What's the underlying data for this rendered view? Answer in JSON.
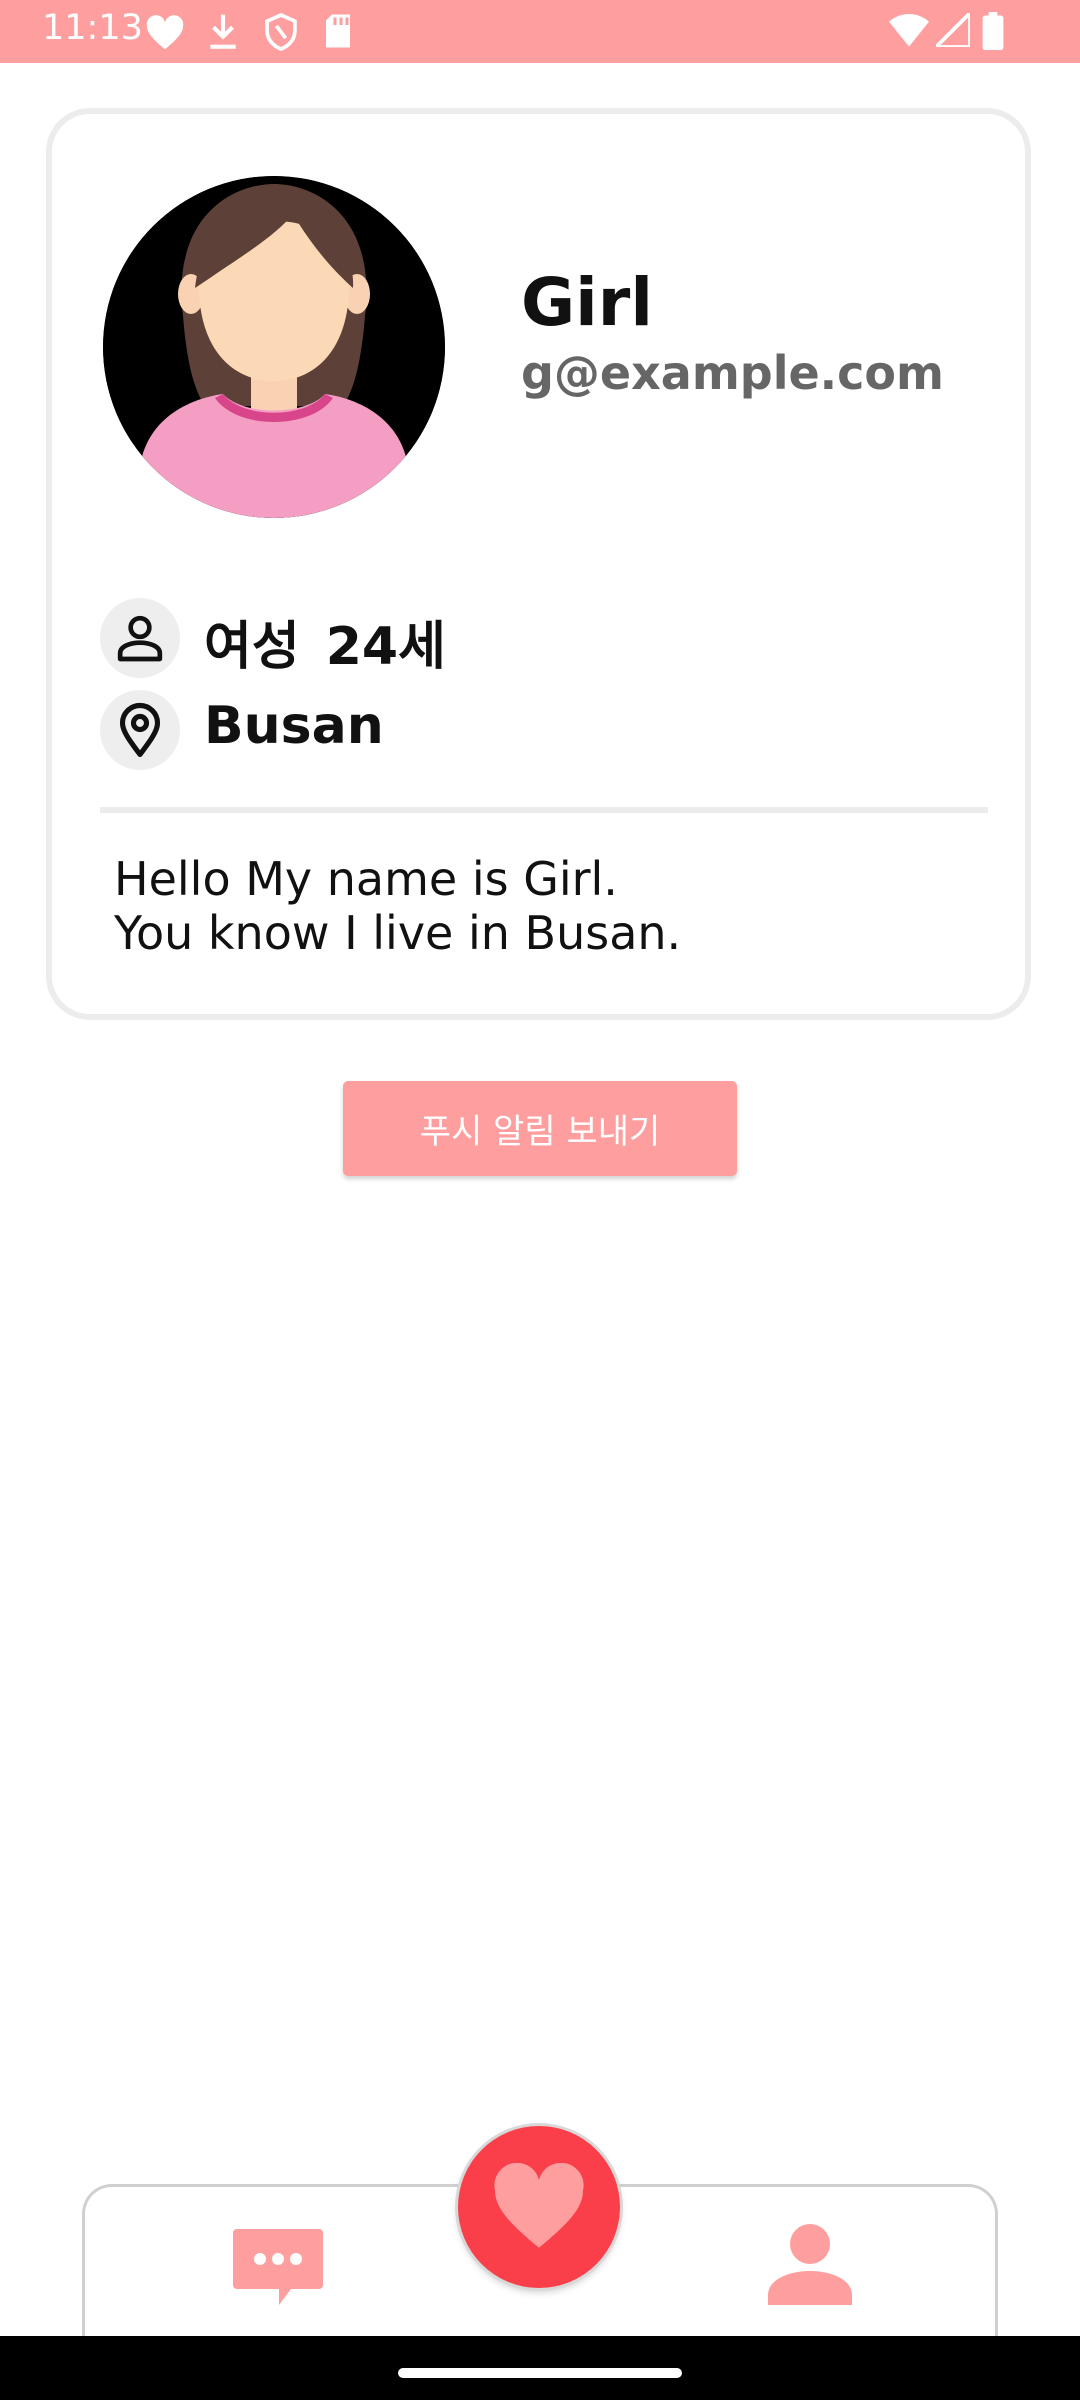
{
  "status_bar": {
    "time": "11:13",
    "left_icons": [
      "heart-icon",
      "download-icon",
      "shield-icon",
      "sd-card-icon"
    ],
    "right_icons": [
      "wifi-icon",
      "cellular-icon",
      "battery-icon"
    ],
    "background_color": "#ff9e9e"
  },
  "profile": {
    "name": "Girl",
    "email": "g@example.com",
    "gender": "여성",
    "age": "24세",
    "location": "Busan",
    "bio_lines": [
      "Hello My name is Girl.",
      "You know I live in Busan."
    ]
  },
  "actions": {
    "push_button_label": "푸시 알림 보내기"
  },
  "bottom_nav": {
    "items": [
      {
        "icon": "chat-icon"
      },
      {
        "icon": "heart-icon",
        "selected": true
      },
      {
        "icon": "person-icon"
      }
    ],
    "accent_color": "#ff9e9e",
    "fab_color": "#fb3f4a"
  }
}
